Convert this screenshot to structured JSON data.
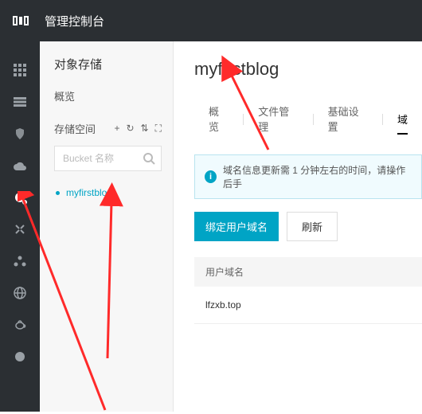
{
  "header": {
    "title": "管理控制台"
  },
  "sidepanel": {
    "title": "对象存储",
    "overview": "概览",
    "space_label": "存储空间",
    "search_placeholder": "Bucket 名称",
    "buckets": [
      {
        "name": "myfirstblog"
      }
    ]
  },
  "main": {
    "title": "myfirstblog",
    "tabs": [
      {
        "label": "概览"
      },
      {
        "label": "文件管理"
      },
      {
        "label": "基础设置"
      },
      {
        "label": "域"
      }
    ],
    "info_banner": "域名信息更新需 1 分钟左右的时间，请操作后手",
    "buttons": {
      "bind": "绑定用户域名",
      "refresh": "刷新"
    },
    "table": {
      "header": "用户域名",
      "rows": [
        {
          "domain": "lfzxb.top"
        }
      ]
    }
  }
}
